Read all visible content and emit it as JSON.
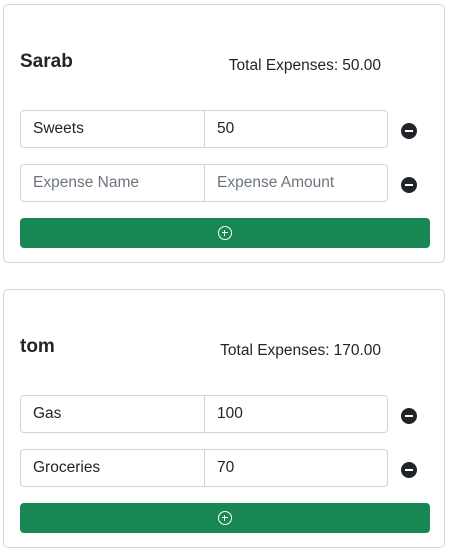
{
  "groups": [
    {
      "name": "Sarab",
      "total_label": "Total Expenses:",
      "total_value": "50.00",
      "expenses": [
        {
          "name": "Sweets",
          "amount": "50"
        },
        {
          "name": "",
          "amount": ""
        }
      ]
    },
    {
      "name": "tom",
      "total_label": "Total Expenses:",
      "total_value": "170.00",
      "expenses": [
        {
          "name": "Gas",
          "amount": "100"
        },
        {
          "name": "Groceries",
          "amount": "70"
        }
      ]
    }
  ],
  "placeholders": {
    "expense_name": "Expense Name",
    "expense_amount": "Expense Amount"
  },
  "colors": {
    "add_button": "#198754",
    "remove_icon": "#212529",
    "card_border": "#d6d6d6"
  },
  "icons": {
    "add": "plus-circle-icon",
    "remove": "dash-circle-fill-icon"
  }
}
